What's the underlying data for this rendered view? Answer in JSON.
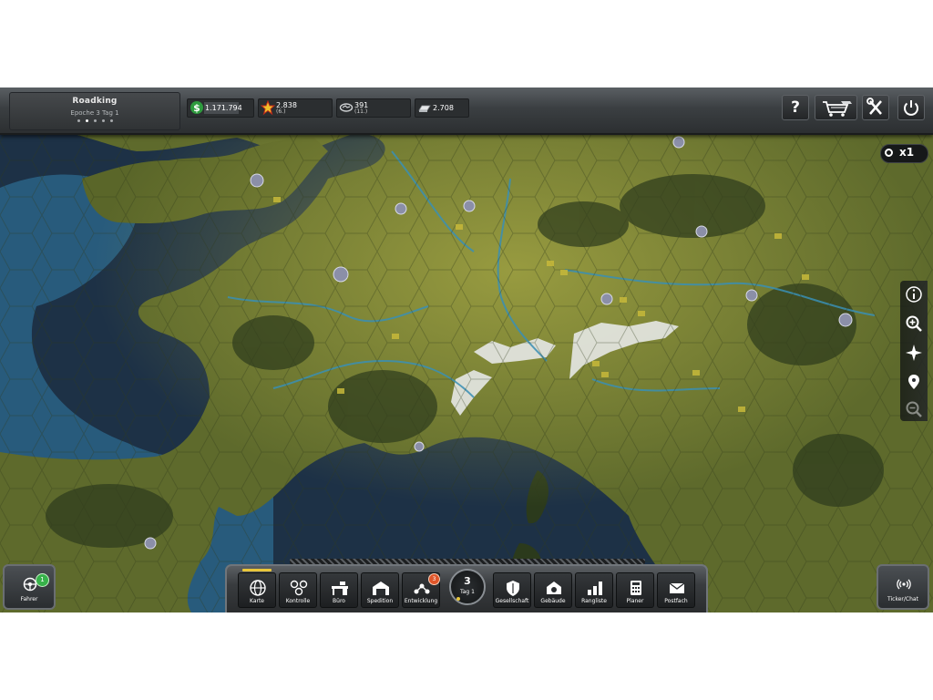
{
  "player": {
    "name": "Roadking",
    "epoch": "Epoche 3 Tag 1",
    "pages": 5,
    "active_page": 2
  },
  "stats": {
    "money": {
      "value": "1.171.794",
      "icon": "dollar-icon"
    },
    "points": {
      "value": "2.838",
      "rank": "(6.)",
      "icon": "star-icon"
    },
    "reputation": {
      "value": "391",
      "rank": "(11.)",
      "icon": "handshake-icon"
    },
    "silver": {
      "value": "2.708",
      "icon": "silver-bar-icon"
    }
  },
  "toolbar": {
    "help_label": "?",
    "icons": [
      "help-icon",
      "shop-cart-icon",
      "tools-icon",
      "power-icon"
    ]
  },
  "speed": {
    "label": "x1"
  },
  "map_tools": [
    "info-icon",
    "zoom-in-icon",
    "compass-icon",
    "location-pin-icon",
    "zoom-out-icon"
  ],
  "driver": {
    "label": "Fahrer",
    "badge": "1"
  },
  "ticker": {
    "label": "Ticker/Chat"
  },
  "nav": {
    "items": [
      {
        "label": "Karte",
        "icon": "globe-icon",
        "active": true
      },
      {
        "label": "Kontrolle",
        "icon": "network-icon"
      },
      {
        "label": "Büro",
        "icon": "desk-icon"
      },
      {
        "label": "Spedition",
        "icon": "depot-icon"
      },
      {
        "label": "Entwicklung",
        "icon": "development-icon",
        "badge": "3"
      },
      {
        "label": "Gesellschaft",
        "icon": "shield-icon"
      },
      {
        "label": "Gebäude",
        "icon": "building-icon"
      },
      {
        "label": "Rangliste",
        "icon": "ranking-icon"
      },
      {
        "label": "Planer",
        "icon": "calculator-icon"
      },
      {
        "label": "Postfach",
        "icon": "mail-icon"
      }
    ],
    "day": {
      "number": "3",
      "label": "Tag 1",
      "progress": 0.15
    }
  },
  "colors": {
    "accent": "#e8c63a",
    "badge_green": "#37b24a",
    "badge_orange": "#e0562a",
    "sea": "#1d3146",
    "land": "#5c6a2a"
  }
}
